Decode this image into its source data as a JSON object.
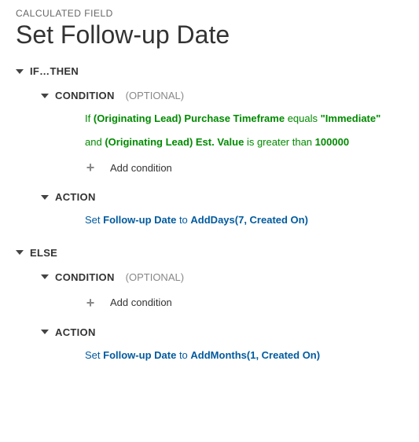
{
  "header": {
    "breadcrumb": "CALCULATED FIELD",
    "title": "Set Follow-up Date"
  },
  "labels": {
    "if_then": "IF…THEN",
    "else": "ELSE",
    "condition": "CONDITION",
    "optional": "(OPTIONAL)",
    "action": "ACTION",
    "add_condition": "Add condition"
  },
  "if_block": {
    "conditions": [
      {
        "prefix": "If",
        "field": "(Originating Lead) Purchase Timeframe",
        "operator": "equals",
        "value": "\"Immediate\""
      },
      {
        "prefix": "and",
        "field": "(Originating Lead) Est. Value",
        "operator": "is greater than",
        "value": "100000"
      }
    ],
    "action": {
      "verb": "Set",
      "target": "Follow-up Date",
      "connector": "to",
      "expression": "AddDays(7, Created On)"
    }
  },
  "else_block": {
    "action": {
      "verb": "Set",
      "target": "Follow-up Date",
      "connector": "to",
      "expression": "AddMonths(1, Created On)"
    }
  }
}
